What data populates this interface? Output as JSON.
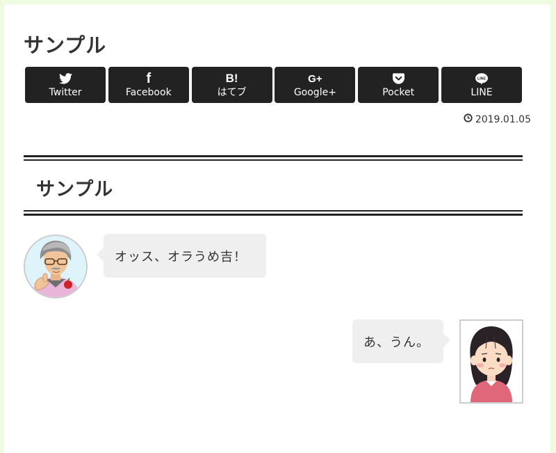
{
  "page": {
    "title": "サンプル"
  },
  "share": {
    "buttons": [
      {
        "label": "Twitter",
        "icon": "twitter-icon"
      },
      {
        "label": "Facebook",
        "icon": "facebook-icon",
        "glyph": "f"
      },
      {
        "label": "はてブ",
        "icon": "hatena-bookmark-icon",
        "glyph": "B!"
      },
      {
        "label": "Google+",
        "icon": "google-plus-icon",
        "glyph": "G+"
      },
      {
        "label": "Pocket",
        "icon": "pocket-icon"
      },
      {
        "label": "LINE",
        "icon": "line-icon",
        "glyph": "LINE"
      }
    ]
  },
  "meta": {
    "date": "2019.01.05",
    "date_icon": "clock-icon"
  },
  "section": {
    "heading": "サンプル"
  },
  "chat": [
    {
      "side": "left",
      "text": "オッス、オラうめ吉！",
      "avatar": "man-with-glasses-avatar"
    },
    {
      "side": "right",
      "text": "あ、うん。",
      "avatar": "woman-avatar"
    }
  ],
  "colors": {
    "page_background": "#eefbe0",
    "share_button": "#222222",
    "bubble": "#efefef",
    "text": "#333333"
  }
}
